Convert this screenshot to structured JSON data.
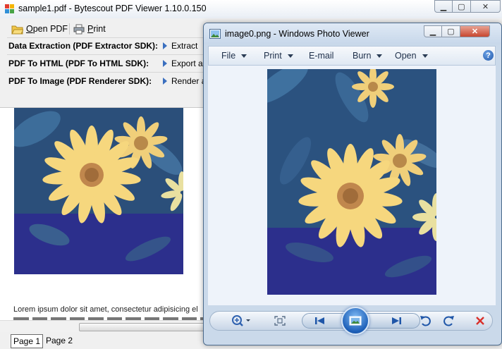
{
  "pdf_viewer": {
    "title": "sample1.pdf - Bytescout PDF Viewer 1.10.0.150",
    "toolbar": {
      "open_label": "Open PDF",
      "print_label": "Print"
    },
    "sdk_rows": [
      {
        "label": "Data Extraction (PDF Extractor SDK):",
        "action": "Extract"
      },
      {
        "label": "PDF To HTML (PDF To HTML SDK):",
        "action": "Export as H"
      },
      {
        "label": "PDF To Image (PDF Renderer SDK):",
        "action": "Render as"
      }
    ],
    "content": {
      "lorem": "Lorem ipsum dolor sit amet, consectetur adipisicing el"
    },
    "page_tabs": [
      "Page 1",
      "Page 2"
    ],
    "active_page": 0
  },
  "photo_viewer": {
    "title": "image0.png - Windows Photo Viewer",
    "menu": [
      {
        "label": "File",
        "has_caret": true
      },
      {
        "label": "Print",
        "has_caret": true
      },
      {
        "label": "E-mail",
        "has_caret": false
      },
      {
        "label": "Burn",
        "has_caret": true
      },
      {
        "label": "Open",
        "has_caret": true
      }
    ],
    "help_label": "?",
    "controls": [
      "zoom-icon",
      "actual-size-icon",
      "previous-icon",
      "slideshow-icon",
      "next-icon",
      "rotate-counterclockwise-icon",
      "rotate-clockwise-icon",
      "delete-icon"
    ]
  },
  "colors": {
    "accent_blue": "#3a6fbf",
    "delete_red": "#d9302a",
    "petal_yellow": "#f6d77e",
    "foliage_blue": "#2e5f91"
  }
}
